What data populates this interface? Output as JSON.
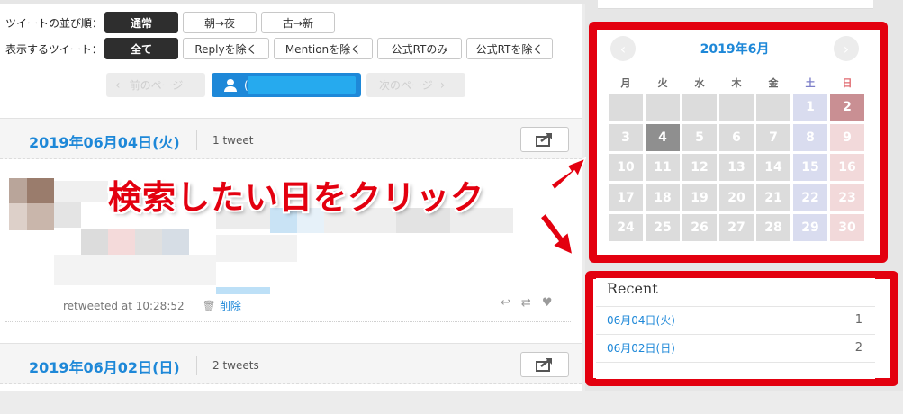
{
  "filters": {
    "order": {
      "label": "ツイートの並び順：",
      "options": [
        "通常",
        "朝→夜",
        "古→新"
      ],
      "active": 0
    },
    "display": {
      "label": "表示するツイート：",
      "options": [
        "全て",
        "Replyを除く",
        "Mentionを除く",
        "公式RTのみ",
        "公式RTを除く"
      ],
      "active": 0
    }
  },
  "pager": {
    "prev_label": "前のページ",
    "user_label": "(",
    "next_label": "次のページ"
  },
  "days": [
    {
      "date": "2019年06月04日(火)",
      "count": "1 tweet"
    },
    {
      "date": "2019年06月02日(日)",
      "count": "2 tweets"
    }
  ],
  "tweet": {
    "retweeted_at": "retweeted at 10:28:52",
    "delete_label": "削除"
  },
  "calendar": {
    "title": "2019年6月",
    "weekdays": [
      "月",
      "火",
      "水",
      "木",
      "金",
      "土",
      "日"
    ],
    "weeks": [
      [
        "",
        "",
        "",
        "",
        "",
        "1",
        "2"
      ],
      [
        "3",
        "4",
        "5",
        "6",
        "7",
        "8",
        "9"
      ],
      [
        "10",
        "11",
        "12",
        "13",
        "14",
        "15",
        "16"
      ],
      [
        "17",
        "18",
        "19",
        "20",
        "21",
        "22",
        "23"
      ],
      [
        "24",
        "25",
        "26",
        "27",
        "28",
        "29",
        "30"
      ]
    ],
    "highlighted_dates": [
      "2",
      "4"
    ],
    "colors": {
      "weekday": "#dcdcdc",
      "saturday": "#d9dcef",
      "sunday": "#f2d9da",
      "selected_weekday": "#8f8f8f",
      "selected_sunday": "#c98f93",
      "title": "#1e88d8"
    }
  },
  "recent": {
    "title": "Recent",
    "items": [
      {
        "date": "06月04日(火)",
        "count": "1"
      },
      {
        "date": "06月02日(日)",
        "count": "2"
      }
    ]
  },
  "annotation": {
    "text": "検索したい日をクリック",
    "color": "#e3000f"
  }
}
